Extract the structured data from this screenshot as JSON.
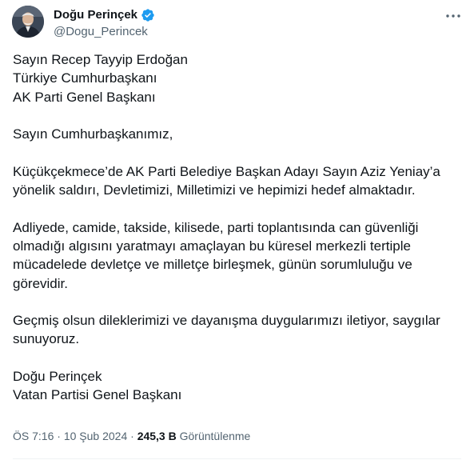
{
  "author": {
    "display_name": "Doğu Perinçek",
    "handle": "@Dogu_Perincek"
  },
  "colors": {
    "verified": "#1d9bf0",
    "text_primary": "#0f1419",
    "text_secondary": "#536471"
  },
  "icons": {
    "verified": "verified-badge-icon",
    "more": "more-horizontal-icon"
  },
  "body": {
    "paragraphs": [
      [
        "Sayın Recep Tayyip Erdoğan",
        "Türkiye Cumhurbaşkanı",
        "AK Parti Genel Başkanı"
      ],
      [
        "Sayın Cumhurbaşkanımız,"
      ],
      [
        "Küçükçekmece’de AK Parti Belediye Başkan Adayı Sayın Aziz Yeniay’a",
        "yönelik saldırı, Devletimizi, Milletimizi ve hepimizi hedef almaktadır."
      ],
      [
        "Adliyede, camide, takside, kilisede, parti toplantısında can güvenliği",
        "olmadığı algısını yaratmayı amaçlayan bu küresel merkezli tertiple",
        "mücadelede devletçe ve milletçe birleşmek, günün sorumluluğu ve",
        "görevidir."
      ],
      [
        "Geçmiş olsun dileklerimizi ve dayanışma duygularımızı iletiyor, saygılar",
        "sunuyoruz."
      ],
      [
        "Doğu Perinçek",
        "Vatan Partisi Genel Başkanı"
      ]
    ]
  },
  "meta": {
    "time": "ÖS 7:16",
    "separator": "·",
    "date": "10 Şub 2024",
    "views_count": "245,3 B",
    "views_label": "Görüntülenme"
  }
}
